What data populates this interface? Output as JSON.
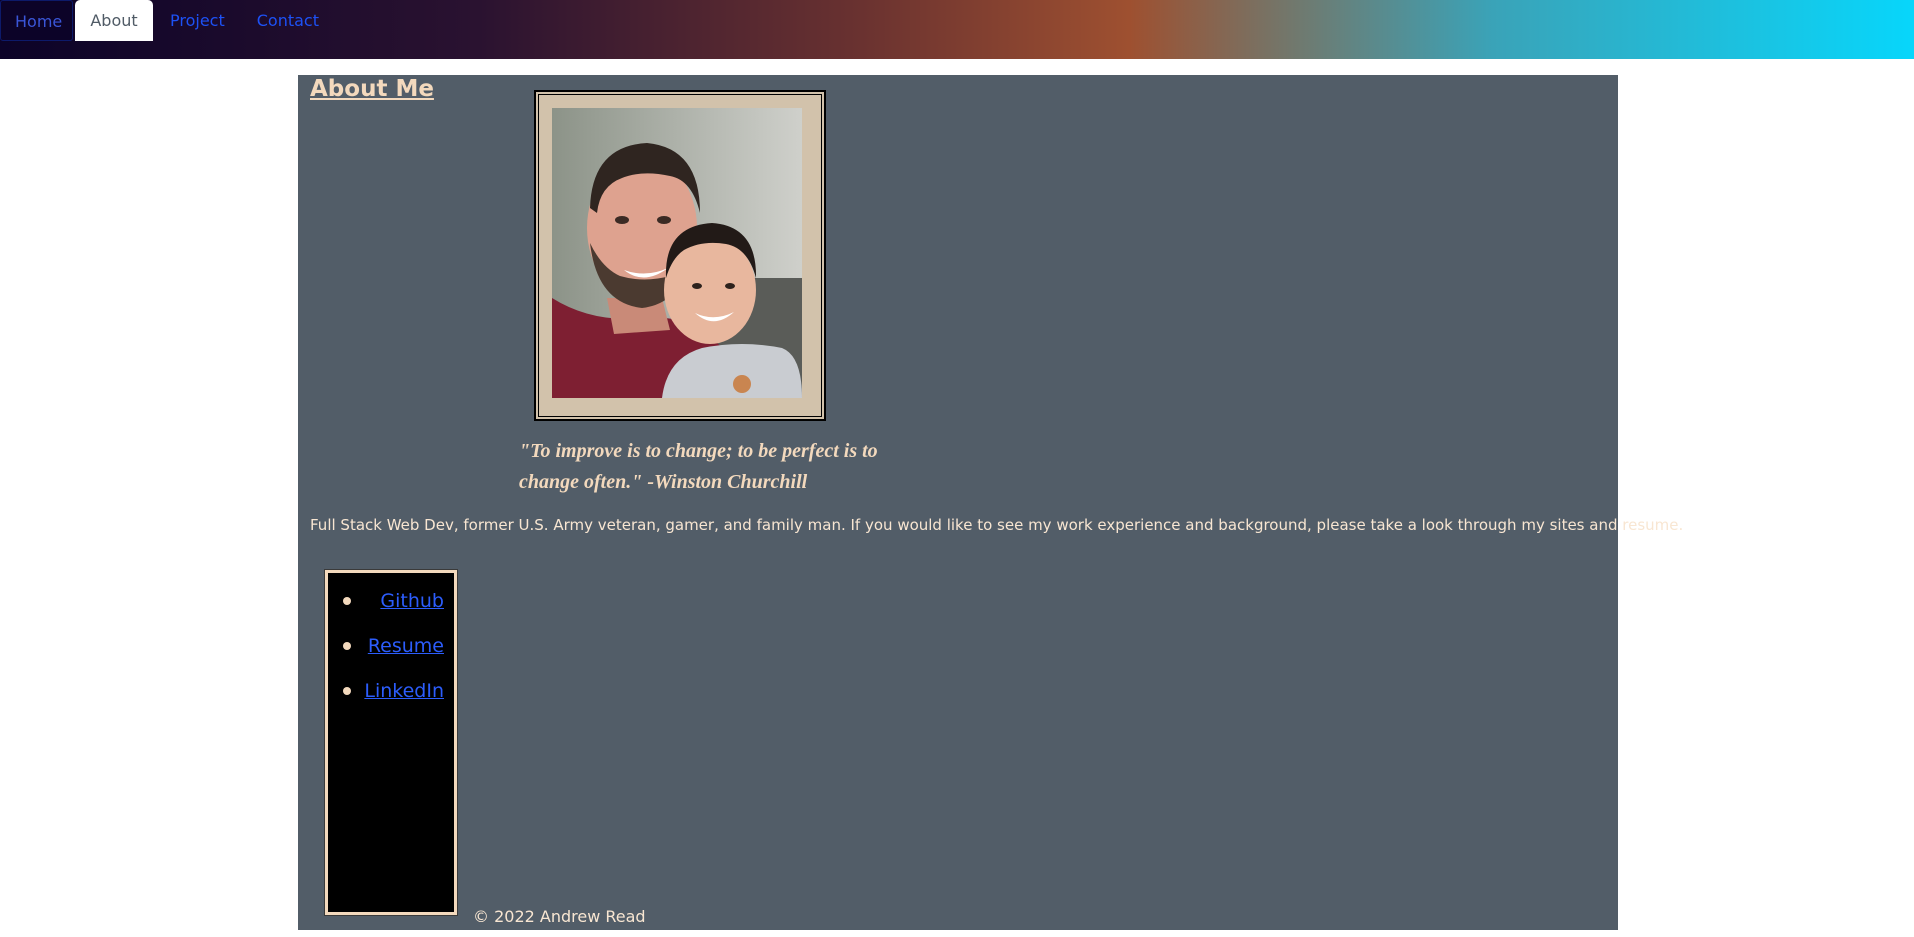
{
  "nav": {
    "items": [
      {
        "label": "Home"
      },
      {
        "label": "About"
      },
      {
        "label": "Project"
      },
      {
        "label": "Contact"
      }
    ],
    "active": "About"
  },
  "about": {
    "title": "About Me",
    "photo_alt": "photo of a smiling bearded man with a young child",
    "quote_line1": "\"To improve is to change; to be perfect is to",
    "quote_line2": "change often.\" -Winston Churchill",
    "bio": "Full Stack Web Dev, former U.S. Army veteran, gamer, and family man. If you would like to see my work experience and background, please take a look through my sites and resume."
  },
  "links": [
    {
      "label": "Github"
    },
    {
      "label": "Resume"
    },
    {
      "label": "LinkedIn"
    }
  ],
  "footer": {
    "text": "© 2022 Andrew Read"
  },
  "colors": {
    "accent_text": "#f3d9bd",
    "panel_bg": "#525d68",
    "link": "#2c5dfc"
  }
}
